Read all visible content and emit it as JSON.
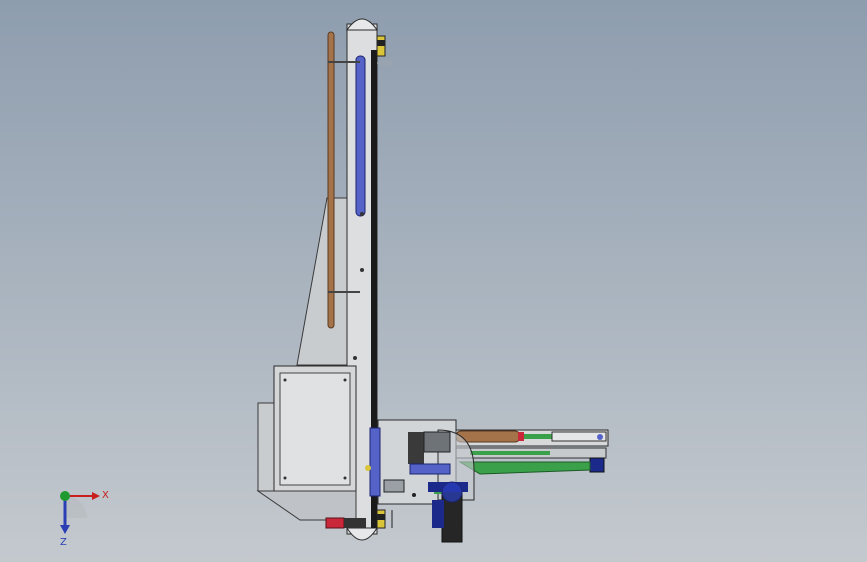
{
  "triad": {
    "x_label": "X",
    "z_label": "Z",
    "x_color": "#c81e1e",
    "y_color": "#1f9a2e",
    "z_color": "#2b3fb5"
  },
  "colors": {
    "background_top": "#8e9dae",
    "background_bottom": "#c4c9ce",
    "frame": "#d6d8db",
    "outline": "#2a2a2a",
    "rail": "#1a1a1a",
    "blue_part": "#5563c9",
    "copper_rod": "#a4734a",
    "green_part": "#3aa04a",
    "navy_motor": "#1b2a8a",
    "yellow_part": "#d9c43a",
    "red_part": "#c8283a"
  }
}
